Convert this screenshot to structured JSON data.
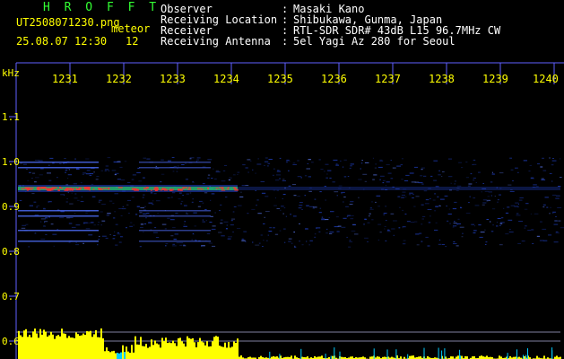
{
  "header": {
    "app_title": "H R O F F T",
    "filename": "UT2508071230.png",
    "meteor_label": "meteor",
    "datetime": "25.08.07 12:30",
    "count": "12"
  },
  "info": [
    {
      "label": "Observer",
      "value": "Masaki Kano"
    },
    {
      "label": "Receiving Location",
      "value": "Shibukawa, Gunma, Japan"
    },
    {
      "label": "Receiver",
      "value": "RTL-SDR SDR# 43dB L15 96.7MHz CW"
    },
    {
      "label": "Receiving Antenna",
      "value": "5el Yagi Az 280 for Seoul"
    }
  ],
  "axis": {
    "y_unit": "kHz",
    "x_ticks": [
      "1231",
      "1232",
      "1233",
      "1234",
      "1235",
      "1236",
      "1237",
      "1238",
      "1239",
      "1240"
    ],
    "y_ticks": [
      "1.1",
      "1.0",
      "0.9",
      "0.8",
      "0.7",
      "0.6"
    ]
  },
  "colors": {
    "grid": "#6060ff",
    "label": "#ffff00",
    "title": "#33ff33",
    "signal_core": "#ff3030",
    "signal_mid": "#30ff60",
    "noise": "#2040c0",
    "meter": "#ffff00",
    "meter_accent": "#00ccff"
  }
}
